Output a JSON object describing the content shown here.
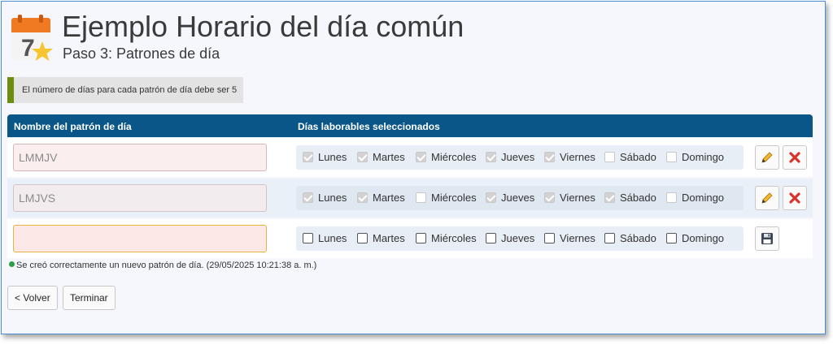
{
  "header": {
    "title": "Ejemplo Horario del día común",
    "subtitle": "Paso 3: Patrones de día",
    "logo_digit": "7"
  },
  "notice": "El número de días para cada patrón de día debe ser 5",
  "table": {
    "headers": [
      "Nombre del patrón de día",
      "Días laborables seleccionados"
    ],
    "day_labels": [
      "Lunes",
      "Martes",
      "Miércoles",
      "Jueves",
      "Viernes",
      "Sábado",
      "Domingo"
    ],
    "rows": [
      {
        "name": "LMMJV",
        "checked": [
          true,
          true,
          true,
          true,
          true,
          false,
          false
        ],
        "mode": "saved"
      },
      {
        "name": "LMJVS",
        "checked": [
          true,
          true,
          false,
          true,
          true,
          true,
          false
        ],
        "mode": "saved"
      },
      {
        "name": "",
        "checked": [
          false,
          false,
          false,
          false,
          false,
          false,
          false
        ],
        "mode": "new"
      }
    ]
  },
  "icons": {
    "edit": "pencil-icon",
    "delete": "x-icon",
    "save": "floppy-disk-icon"
  },
  "colors": {
    "header_bg": "#0b5688",
    "notice_bar": "#6b8e0e",
    "delete": "#d9342b",
    "success": "#2e9e46"
  },
  "status_message": "Se creó correctamente un nuevo patrón de día. (29/05/2025 10:21:38 a. m.)",
  "buttons": {
    "back": "< Volver",
    "finish": "Terminar"
  }
}
